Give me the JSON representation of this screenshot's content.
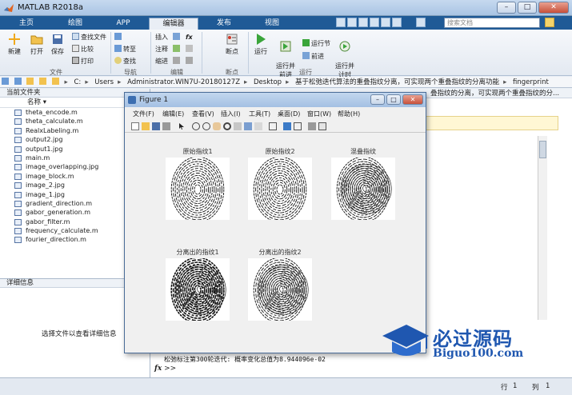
{
  "window": {
    "title": "MATLAB R2018a",
    "minimize": "–",
    "maximize": "□",
    "close": "✕"
  },
  "ribbon_tabs": [
    "主页",
    "绘图",
    "APP",
    "编辑器",
    "发布",
    "视图"
  ],
  "search": {
    "placeholder": "搜索文档"
  },
  "ribbon": {
    "new": "新建",
    "open": "打开",
    "save": "保存",
    "find_files": "查找文件",
    "compare": "比较",
    "print": "打印",
    "insert": "插入",
    "comment": "注释",
    "indent": "缩进",
    "goto": "转至",
    "find": "查找",
    "breakpoints": "断点",
    "run": "运行",
    "run_advance": "运行并\n前进",
    "run_section": "运行节",
    "advance": "前进",
    "run_time": "运行并\n计时",
    "groups": {
      "file": "文件",
      "navigate": "导航",
      "edit": "编辑",
      "breakpoints": "断点",
      "run": "运行"
    }
  },
  "address": {
    "crumbs": [
      "C:",
      "Users",
      "Administrator.WIN7U-20180127Z",
      "Desktop",
      "基于松弛迭代算法的重叠指纹分离，可实现两个重叠指纹的分离功能",
      "fingerprint"
    ]
  },
  "current_folder": {
    "title": "当前文件夹",
    "column": "名称",
    "files": [
      "theta_encode.m",
      "theta_calculate.m",
      "RealxLabeling.m",
      "output2.jpg",
      "output1.jpg",
      "main.m",
      "image_overlapping.jpg",
      "image_block.m",
      "image_2.jpg",
      "image_1.jpg",
      "gradient_direction.m",
      "gabor_generation.m",
      "gabor_filter.m",
      "frequency_calculate.m",
      "fourier_direction.m"
    ]
  },
  "details": {
    "title": "详细信息",
    "message": "选择文件以查看详细信息"
  },
  "command_window": {
    "header": "叠指纹的分离，可实现两个重叠指纹的分...",
    "output": "松弛标注第300轮迭代: 概率变化总值为8.944096e-02",
    "prompt": ">>",
    "fx": "fx"
  },
  "status": {
    "row_label": "行",
    "row_value": "1",
    "col_label": "列",
    "col_value": "1"
  },
  "figure": {
    "title": "Figure 1",
    "menu": [
      "文件(F)",
      "编辑(E)",
      "查看(V)",
      "插入(I)",
      "工具(T)",
      "桌面(D)",
      "窗口(W)",
      "帮助(H)"
    ],
    "subplots": [
      "原始指纹1",
      "原始指纹2",
      "混叠指纹",
      "分离出的指纹1",
      "分离出的指纹2"
    ]
  },
  "watermark": {
    "title": "必过源码",
    "url": "Biguo100.com"
  },
  "colors": {
    "tabbar": "#1f5a96",
    "accent": "#1f57b0",
    "notice": "#fff7d4"
  }
}
